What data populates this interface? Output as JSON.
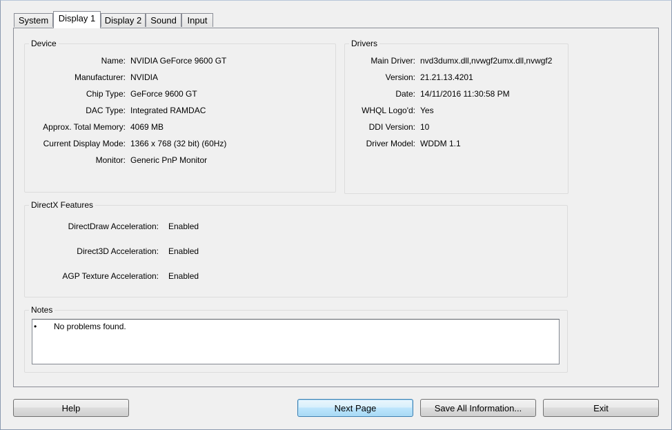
{
  "tabs": [
    "System",
    "Display 1",
    "Display 2",
    "Sound",
    "Input"
  ],
  "device": {
    "title": "Device",
    "rows": [
      {
        "label": "Name:",
        "value": "NVIDIA GeForce 9600 GT"
      },
      {
        "label": "Manufacturer:",
        "value": "NVIDIA"
      },
      {
        "label": "Chip Type:",
        "value": "GeForce 9600 GT"
      },
      {
        "label": "DAC Type:",
        "value": "Integrated RAMDAC"
      },
      {
        "label": "Approx. Total Memory:",
        "value": "4069 MB"
      },
      {
        "label": "Current Display Mode:",
        "value": "1366 x 768 (32 bit) (60Hz)"
      },
      {
        "label": "Monitor:",
        "value": "Generic PnP Monitor"
      }
    ]
  },
  "drivers": {
    "title": "Drivers",
    "rows": [
      {
        "label": "Main Driver:",
        "value": "nvd3dumx.dll,nvwgf2umx.dll,nvwgf2"
      },
      {
        "label": "Version:",
        "value": "21.21.13.4201"
      },
      {
        "label": "Date:",
        "value": "14/11/2016 11:30:58 PM"
      },
      {
        "label": "WHQL Logo'd:",
        "value": "Yes"
      },
      {
        "label": "DDI Version:",
        "value": "10"
      },
      {
        "label": "Driver Model:",
        "value": "WDDM 1.1"
      }
    ]
  },
  "directx": {
    "title": "DirectX Features",
    "rows": [
      {
        "label": "DirectDraw Acceleration:",
        "value": "Enabled"
      },
      {
        "label": "Direct3D Acceleration:",
        "value": "Enabled"
      },
      {
        "label": "AGP Texture Acceleration:",
        "value": "Enabled"
      }
    ]
  },
  "notes": {
    "title": "Notes",
    "bullet": "•",
    "items": [
      "No problems found."
    ]
  },
  "buttons": {
    "help": "Help",
    "next_page": "Next Page",
    "save_all": "Save All Information...",
    "exit": "Exit"
  }
}
